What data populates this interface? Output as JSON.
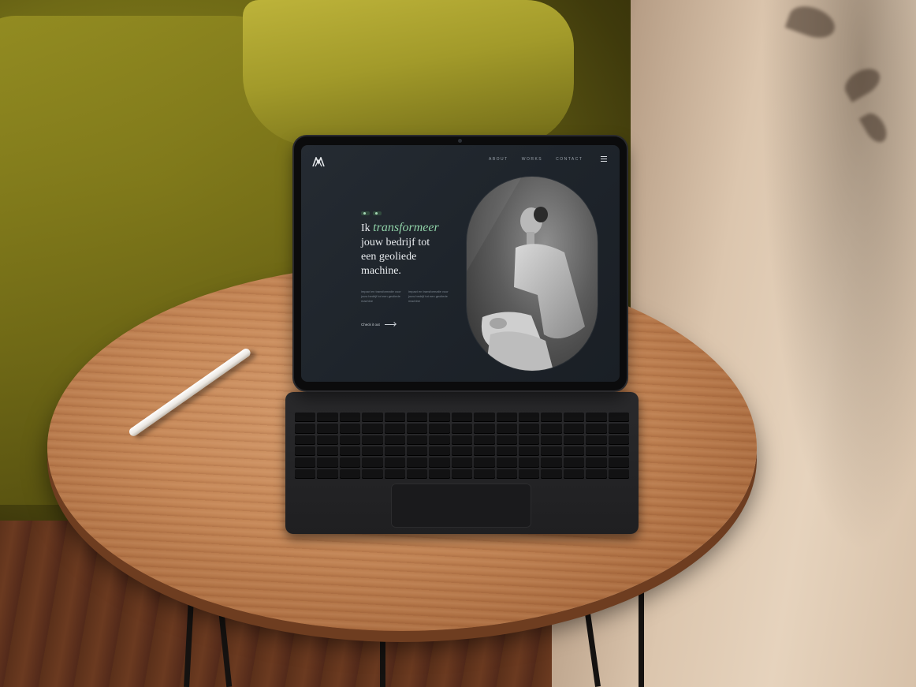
{
  "screen": {
    "nav": {
      "about": "ABOUT",
      "works": "WORKS",
      "contact": "CONTACT"
    },
    "badges": [
      "",
      ""
    ],
    "headline": {
      "line1_prefix": "Ik ",
      "line1_accent": "transformeer",
      "line2": "jouw bedrijf tot",
      "line3": "een geoliede",
      "line4": "machine."
    },
    "body_col1": "impact en transformatie voor jouw bedrijf tot een geoliede machine",
    "body_col2": "impact en transformatie voor jouw bedrijf tot een geoliede machine",
    "cta": "Check it out"
  },
  "colors": {
    "accent": "#8fd1a7",
    "screen_bg": "#1e242b",
    "sofa": "#7b7419",
    "table": "#c48656"
  },
  "icons": {
    "logo": "m-logo-icon",
    "menu": "hamburger-menu-icon",
    "cta": "arrow-right-icon"
  }
}
